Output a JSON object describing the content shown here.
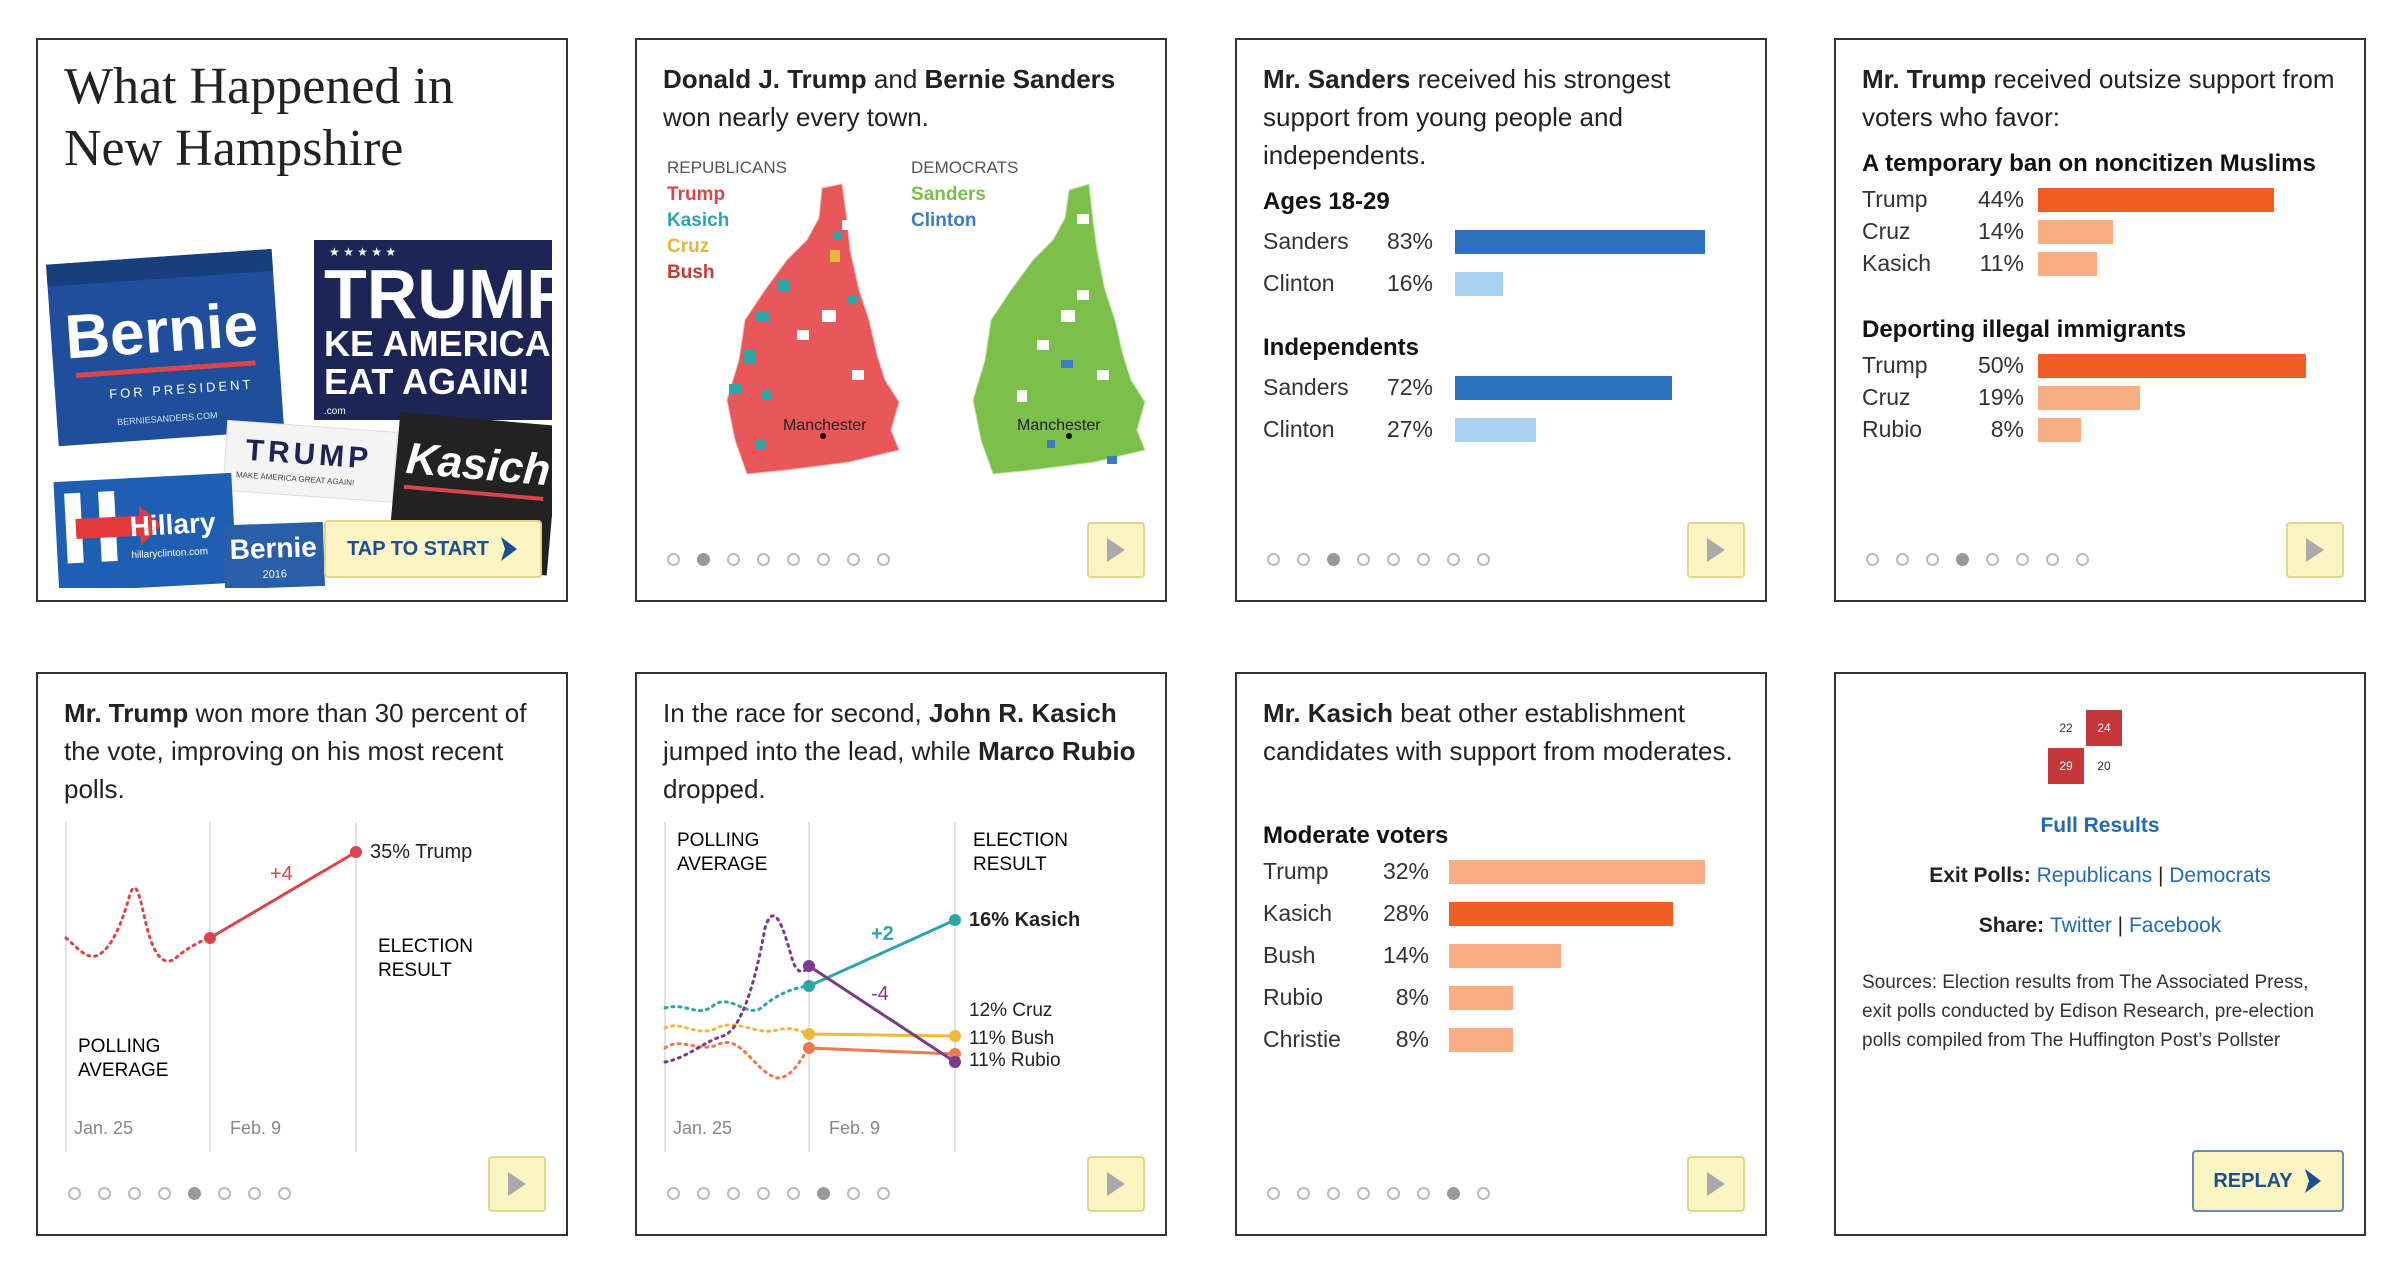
{
  "cards": {
    "intro": {
      "title": "What Happened in New Hampshire",
      "tap_to_start": "TAP TO START",
      "poster_bernie": "Bernie",
      "poster_bernie_sub": "FOR PRESIDENT",
      "poster_bernie_url": "BERNIESANDERS.COM",
      "poster_trump": "TRUMP",
      "poster_trump_sub1": "KE AMERICA",
      "poster_trump_sub2": "EAT AGAIN!",
      "poster_trump_site": ".com",
      "poster_trump2": "TRUMP",
      "poster_trump2_sub": "MAKE AMERICA GREAT AGAIN!",
      "poster_kasich": "Kasich",
      "poster_hillary": "Hillary",
      "poster_hillary_url": "hillaryclinton.com",
      "poster_bernie2": "Bernie",
      "poster_bernie2_year": "2016"
    },
    "maps": {
      "headline_b1": "Donald J. Trump",
      "headline_t1": " and ",
      "headline_b2": "Bernie Sanders",
      "headline_t2": " won nearly every town.",
      "rep_label": "REPUBLICANS",
      "rep_names": [
        "Trump",
        "Kasich",
        "Cruz",
        "Bush"
      ],
      "rep_colors": [
        "#d9454a",
        "#2da6a6",
        "#e5b73b",
        "#c23b3b"
      ],
      "dem_label": "DEMOCRATS",
      "dem_names": [
        "Sanders",
        "Clinton"
      ],
      "dem_colors": [
        "#7cc04b",
        "#3b7cc4"
      ],
      "city": "Manchester",
      "map_colors": {
        "rep_fill": "#e8575a",
        "dem_fill": "#7cc04b"
      }
    },
    "sanders": {
      "headline_b": "Mr. Sanders",
      "headline_t": " received his strongest support from young people and independents.",
      "groups": [
        {
          "title": "Ages 18-29",
          "rows": [
            {
              "name": "Sanders",
              "pct": "83%",
              "value": 83
            },
            {
              "name": "Clinton",
              "pct": "16%",
              "value": 16
            }
          ]
        },
        {
          "title": "Independents",
          "rows": [
            {
              "name": "Sanders",
              "pct": "72%",
              "value": 72
            },
            {
              "name": "Clinton",
              "pct": "27%",
              "value": 27
            }
          ]
        }
      ]
    },
    "trump_support": {
      "headline_b": "Mr. Trump",
      "headline_t": " received outsize support from voters who favor:",
      "groups": [
        {
          "title": "A temporary ban on noncitizen Muslims",
          "rows": [
            {
              "name": "Trump",
              "pct": "44%",
              "value": 44
            },
            {
              "name": "Cruz",
              "pct": "14%",
              "value": 14
            },
            {
              "name": "Kasich",
              "pct": "11%",
              "value": 11
            }
          ]
        },
        {
          "title": "Deporting illegal immigrants",
          "rows": [
            {
              "name": "Trump",
              "pct": "50%",
              "value": 50
            },
            {
              "name": "Cruz",
              "pct": "19%",
              "value": 19
            },
            {
              "name": "Rubio",
              "pct": "8%",
              "value": 8
            }
          ]
        }
      ]
    },
    "trump_line": {
      "headline_b": "Mr. Trump",
      "headline_t": " won more than 30 percent of the vote, improving on his most recent polls.",
      "change": "+4",
      "result_label": "35%  Trump",
      "election_result_1": "ELECTION",
      "election_result_2": "RESULT",
      "polling_avg_1": "POLLING",
      "polling_avg_2": "AVERAGE",
      "date1": "Jan. 25",
      "date2": "Feb. 9"
    },
    "race_second": {
      "headline_t1": "In the race for second, ",
      "headline_b1": "John R. Kasich",
      "headline_t2": " jumped into the lead, while ",
      "headline_b2": "Marco Rubio",
      "headline_t3": " dropped.",
      "polling_avg_1": "POLLING",
      "polling_avg_2": "AVERAGE",
      "election_result_1": "ELECTION",
      "election_result_2": "RESULT",
      "kasich_change": "+2",
      "rubio_change": "-4",
      "kasich_label": "16% Kasich",
      "cruz_label": "12%  Cruz",
      "bush_label": "11%  Bush",
      "rubio_label": "11%  Rubio",
      "date1": "Jan. 25",
      "date2": "Feb. 9",
      "colors": {
        "kasich": "#2da6a6",
        "cruz": "#f0b93a",
        "bush": "#ea7a4f",
        "rubio": "#7b3a8c"
      }
    },
    "kasich": {
      "headline_b": "Mr. Kasich",
      "headline_t": " beat other establishment candidates with support from moderates.",
      "group_title": "Moderate voters",
      "rows": [
        {
          "name": "Trump",
          "pct": "32%",
          "value": 32
        },
        {
          "name": "Kasich",
          "pct": "28%",
          "value": 28
        },
        {
          "name": "Bush",
          "pct": "14%",
          "value": 14
        },
        {
          "name": "Rubio",
          "pct": "8%",
          "value": 8
        },
        {
          "name": "Christie",
          "pct": "8%",
          "value": 8
        }
      ]
    },
    "final": {
      "delegate_numbers": [
        "22",
        "24",
        "29",
        "20"
      ],
      "full_results": "Full Results",
      "exit_polls_label": "Exit Polls: ",
      "exit_polls_rep": "Republicans",
      "exit_polls_sep": " | ",
      "exit_polls_dem": "Democrats",
      "share_label": "Share: ",
      "share_twitter": "Twitter",
      "share_sep": " | ",
      "share_facebook": "Facebook",
      "sources": "Sources: Election results from The Associated Press, exit polls conducted by Edison Research, pre-election polls compiled from The Huffington Post’s Pollster",
      "replay": "REPLAY"
    }
  },
  "progress": {
    "total": 8,
    "active_by_card": [
      2,
      3,
      4,
      5,
      6,
      7
    ]
  }
}
